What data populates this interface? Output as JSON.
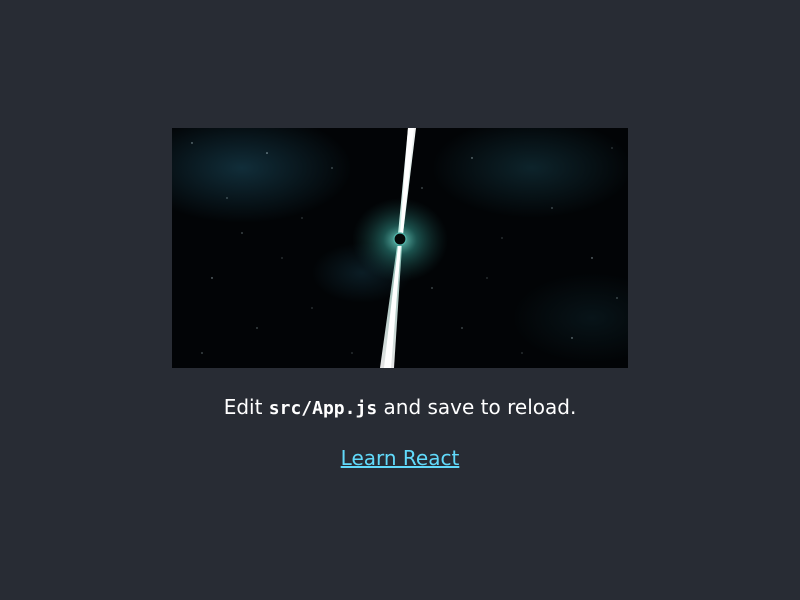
{
  "app": {
    "background": "#282c34",
    "text_color": "#ffffff",
    "link_color": "#61dafb"
  },
  "hero": {
    "icon": "pulsar-space-image"
  },
  "edit_line": {
    "prefix": "Edit ",
    "code": "src/App.js",
    "suffix": " and save to reload."
  },
  "link": {
    "label": "Learn React"
  }
}
